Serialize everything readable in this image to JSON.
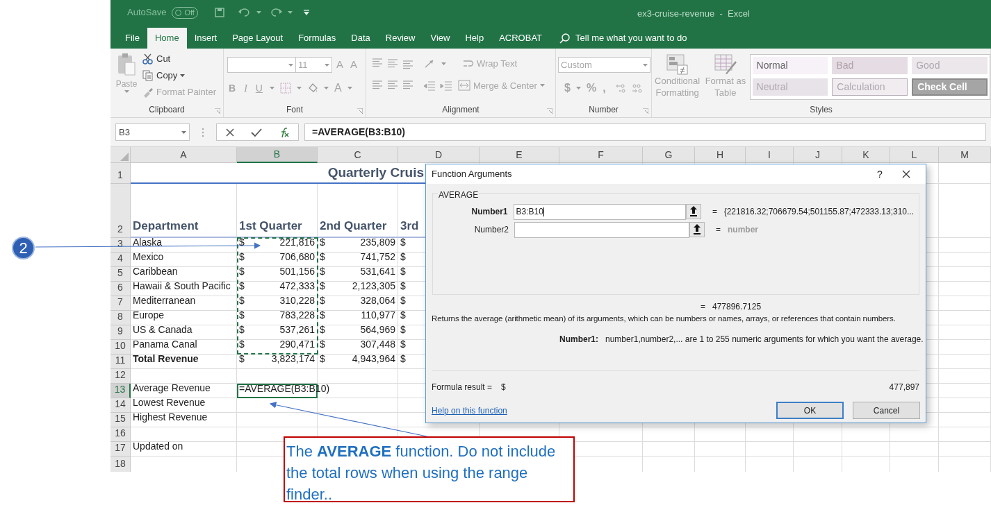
{
  "title_bar": {
    "autosave_label": "AutoSave",
    "autosave_state": "Off",
    "title": "ex3-cruise-revenue  -  Excel"
  },
  "ribbon_tabs": [
    {
      "label": "File",
      "selected": false
    },
    {
      "label": "Home",
      "selected": true
    },
    {
      "label": "Insert",
      "selected": false
    },
    {
      "label": "Page Layout",
      "selected": false
    },
    {
      "label": "Formulas",
      "selected": false
    },
    {
      "label": "Data",
      "selected": false
    },
    {
      "label": "Review",
      "selected": false
    },
    {
      "label": "View",
      "selected": false
    },
    {
      "label": "Help",
      "selected": false
    },
    {
      "label": "ACROBAT",
      "selected": false
    }
  ],
  "tell_me": "Tell me what you want to do",
  "clipboard": {
    "label": "Clipboard",
    "items": [
      {
        "label": "Paste",
        "disabled": true
      },
      {
        "label": "Cut",
        "disabled": false
      },
      {
        "label": "Copy",
        "disabled": false
      },
      {
        "label": "Format Painter",
        "disabled": true
      }
    ]
  },
  "font": {
    "label": "Font",
    "size": "11",
    "size_buttons": [
      "A",
      "A"
    ],
    "style_buttons": [
      "B",
      "I",
      "U"
    ],
    "color_button": "A"
  },
  "alignment": {
    "label": "Alignment",
    "wrap": "Wrap Text",
    "merge": "Merge & Center"
  },
  "number": {
    "label": "Number",
    "format": "Custom",
    "buttons": [
      "$",
      "%",
      ","
    ]
  },
  "styles": {
    "label": "Styles",
    "conditional": "Conditional Formatting",
    "table": "Format as Table",
    "cells": [
      {
        "label": "Normal",
        "kind": "normal"
      },
      {
        "label": "Bad",
        "kind": "bad"
      },
      {
        "label": "Good",
        "kind": "good"
      },
      {
        "label": "Neutral",
        "kind": "neutral"
      },
      {
        "label": "Calculation",
        "kind": "calculation"
      },
      {
        "label": "Check Cell",
        "kind": "check"
      }
    ]
  },
  "formula_bar": {
    "name_box": "B3",
    "formula": "=AVERAGE(B3:B10)"
  },
  "columns": [
    {
      "label": "A",
      "selected": false
    },
    {
      "label": "B",
      "selected": true
    },
    {
      "label": "C",
      "selected": false
    },
    {
      "label": "D",
      "selected": false
    },
    {
      "label": "E",
      "selected": false
    },
    {
      "label": "F",
      "selected": false
    },
    {
      "label": "G",
      "selected": false
    },
    {
      "label": "H",
      "selected": false
    },
    {
      "label": "I",
      "selected": false
    },
    {
      "label": "J",
      "selected": false
    },
    {
      "label": "K",
      "selected": false
    },
    {
      "label": "L",
      "selected": false
    },
    {
      "label": "M",
      "selected": false
    }
  ],
  "rows": [
    {
      "number": "1",
      "selected": false,
      "title": "Quarterly Cruis"
    },
    {
      "number": "2",
      "selected": false,
      "kind": "header",
      "a": "Department",
      "b": "1st Quarter",
      "c": "2nd Quarter",
      "d": "3rd"
    },
    {
      "number": "3",
      "selected": false,
      "a": "Alaska",
      "b_sign": "$",
      "b": "221,816",
      "c_sign": "$",
      "c": "235,809",
      "d_sign": "$"
    },
    {
      "number": "4",
      "selected": false,
      "a": "Mexico",
      "b_sign": "$",
      "b": "706,680",
      "c_sign": "$",
      "c": "741,752",
      "d_sign": "$"
    },
    {
      "number": "5",
      "selected": false,
      "a": "Caribbean",
      "b_sign": "$",
      "b": "501,156",
      "c_sign": "$",
      "c": "531,641",
      "d_sign": "$"
    },
    {
      "number": "6",
      "selected": false,
      "a": "Hawaii & South Pacific",
      "b_sign": "$",
      "b": "472,333",
      "c_sign": "$",
      "c": "2,123,305",
      "d_sign": "$"
    },
    {
      "number": "7",
      "selected": false,
      "a": "Mediterranean",
      "b_sign": "$",
      "b": "310,228",
      "c_sign": "$",
      "c": "328,064",
      "d_sign": "$"
    },
    {
      "number": "8",
      "selected": false,
      "a": "Europe",
      "b_sign": "$",
      "b": "783,228",
      "c_sign": "$",
      "c": "110,977",
      "d_sign": "$"
    },
    {
      "number": "9",
      "selected": false,
      "a": "US & Canada",
      "b_sign": "$",
      "b": "537,261",
      "c_sign": "$",
      "c": "564,969",
      "d_sign": "$"
    },
    {
      "number": "10",
      "selected": false,
      "a": "Panama Canal",
      "b_sign": "$",
      "b": "290,471",
      "c_sign": "$",
      "c": "307,448",
      "d_sign": "$"
    },
    {
      "number": "11",
      "selected": false,
      "kind": "total",
      "a": "Total Revenue",
      "b_sign": "$",
      "b": "3,823,174",
      "c_sign": "$",
      "c": "4,943,964",
      "d_sign": "$"
    },
    {
      "number": "12",
      "selected": false
    },
    {
      "number": "13",
      "selected": true,
      "a": "Average Revenue",
      "editing": "=AVERAGE(B3:B10)"
    },
    {
      "number": "14",
      "selected": false,
      "a": "Lowest Revenue"
    },
    {
      "number": "15",
      "selected": false,
      "a": "Highest Revenue"
    },
    {
      "number": "16",
      "selected": false
    },
    {
      "number": "17",
      "selected": false,
      "a": "Updated on"
    },
    {
      "number": "18",
      "selected": false
    }
  ],
  "dialog": {
    "title": "Function Arguments",
    "help": "?",
    "function_name": "AVERAGE",
    "arguments": [
      {
        "label": "Number1",
        "active": true,
        "value": "B3:B10",
        "equals": "=",
        "result": "{221816.32;706679.54;501155.87;472333.13;310...",
        "hint": false
      },
      {
        "label": "Number2",
        "active": false,
        "equals": "=",
        "result": "number",
        "hint": true
      }
    ],
    "total_equals": "=",
    "total": "477896.7125",
    "description": "Returns the average (arithmetic mean) of its arguments, which can be numbers or names, arrays, or references that contain numbers.",
    "arg_help_label": "Number1:",
    "arg_help": "number1,number2,... are 1 to 255 numeric arguments for which you want the average.",
    "result_label": "Formula result =",
    "result_currency": "$",
    "result_value": "477,897",
    "help_link": "Help on this function",
    "buttons": [
      {
        "label": "OK",
        "default": true
      },
      {
        "label": "Cancel",
        "default": false
      }
    ]
  },
  "callout": {
    "number": "2"
  },
  "note": "The **AVERAGE** function.  Do not include the total rows when using the range finder.."
}
